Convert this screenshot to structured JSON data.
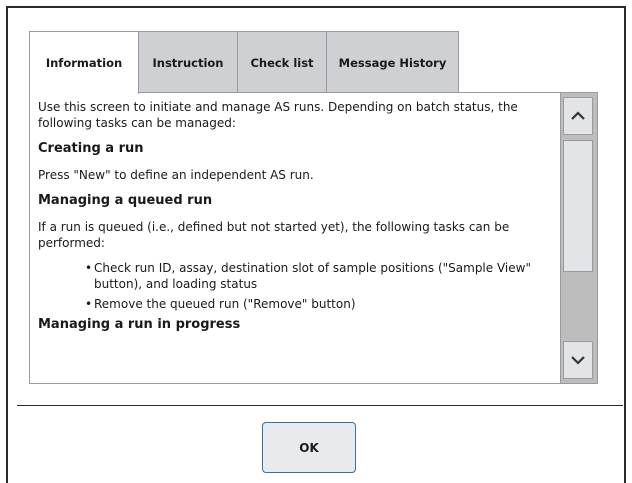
{
  "tabs": [
    {
      "label": "Information",
      "active": true
    },
    {
      "label": "Instruction",
      "active": false
    },
    {
      "label": "Check list",
      "active": false
    },
    {
      "label": "Message History",
      "active": false
    }
  ],
  "content": {
    "intro": "Use this screen to initiate and manage AS runs. Depending on batch status, the following tasks can be managed:",
    "heading_create": "Creating a run",
    "create_text": "Press \"New\" to define an independent AS run.",
    "heading_queued": "Managing a queued run",
    "queued_text": "If a run is queued (i.e., defined but not started yet), the following tasks can be performed:",
    "queued_items": [
      "Check run ID, assay, destination slot of sample positions (\"Sample View\" button), and loading status",
      "Remove the queued run (\"Remove\" button)"
    ],
    "heading_progress": "Managing a run in progress"
  },
  "scrollbar": {
    "up_icon": "chevron-up-icon",
    "down_icon": "chevron-down-icon"
  },
  "footer": {
    "ok_label": "OK"
  },
  "colors": {
    "tab_inactive": "#cfd0d4",
    "tab_active": "#ffffff",
    "button_border": "#3a6ea5",
    "scrollbar_track": "#bdbdbd"
  }
}
